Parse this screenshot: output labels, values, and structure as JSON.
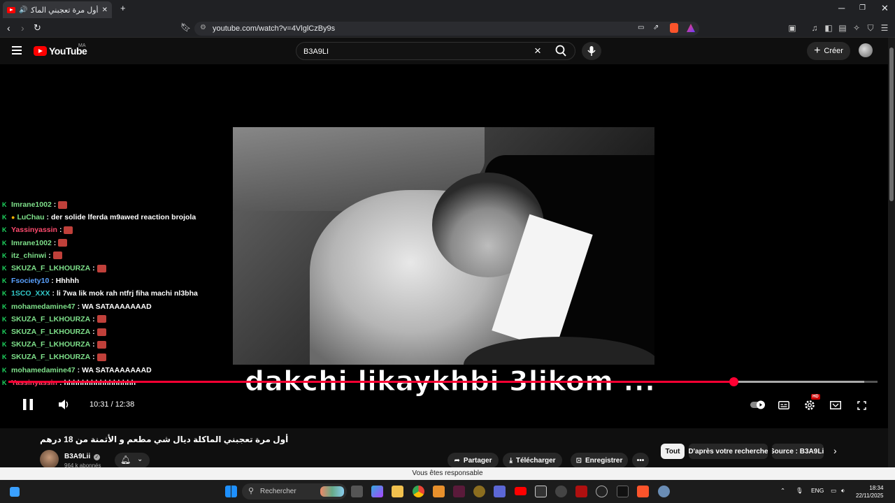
{
  "browser": {
    "tab_title": "أول مرة تعجبني الماكلة ديال شـ",
    "url": "youtube.com/watch?v=4VlglCzBy9s",
    "new_tab": "+",
    "close": "✕"
  },
  "youtube": {
    "logo_text": "YouTube",
    "country_code": "MA",
    "search_value": "B3A9LI",
    "create_label": "Créer"
  },
  "chat": [
    {
      "user": "Imrane1002",
      "user_color": "#7ee08a",
      "message": "",
      "emoji": true,
      "badge": false
    },
    {
      "user": "LuChau",
      "user_color": "#7ee08a",
      "message": "der solide lferda m9awed reaction brojola",
      "emoji": false,
      "badge": true
    },
    {
      "user": "Yassinyassin",
      "user_color": "#ff4b6e",
      "message": "",
      "emoji": true,
      "badge": false
    },
    {
      "user": "Imrane1002",
      "user_color": "#7ee08a",
      "message": "",
      "emoji": true,
      "badge": false
    },
    {
      "user": "itz_chinwi",
      "user_color": "#7ee08a",
      "message": "",
      "emoji": true,
      "badge": false
    },
    {
      "user": "SKUZA_F_LKHOURZA",
      "user_color": "#7ee08a",
      "message": "",
      "emoji": true,
      "badge": false
    },
    {
      "user": "Fsociety10",
      "user_color": "#5aa2ff",
      "message": "Hhhhh",
      "emoji": false,
      "badge": false
    },
    {
      "user": "1SCO_XXX",
      "user_color": "#32c8c8",
      "message": "li 7wa lik mok rah ntfrj fiha machi nl3bha",
      "emoji": false,
      "badge": false
    },
    {
      "user": "mohamedamine47",
      "user_color": "#7ee08a",
      "message": "WA SATAAAAAAAD",
      "emoji": false,
      "badge": false
    },
    {
      "user": "SKUZA_F_LKHOURZA",
      "user_color": "#7ee08a",
      "message": "",
      "emoji": true,
      "badge": false
    },
    {
      "user": "SKUZA_F_LKHOURZA",
      "user_color": "#7ee08a",
      "message": "",
      "emoji": true,
      "badge": false
    },
    {
      "user": "SKUZA_F_LKHOURZA",
      "user_color": "#7ee08a",
      "message": "",
      "emoji": true,
      "badge": false
    },
    {
      "user": "SKUZA_F_LKHOURZA",
      "user_color": "#7ee08a",
      "message": "",
      "emoji": true,
      "badge": false
    },
    {
      "user": "mohamedamine47",
      "user_color": "#7ee08a",
      "message": "WA SATAAAAAAAD",
      "emoji": false,
      "badge": false
    },
    {
      "user": "Yassinyassin",
      "user_color": "#ff4b6e",
      "message": "hhhhhhhhhhhhhhhh",
      "emoji": false,
      "badge": false
    }
  ],
  "player": {
    "subtitle": "dakchi likaykhbi 3likom  ...",
    "time": "10:31 / 12:38",
    "progress_fraction": 0.834,
    "buffered_fraction": 0.985,
    "accent": "#ff0033",
    "hd_badge": "HD"
  },
  "video": {
    "title": "أول مرة تعجبني الماكلة ديال شي مطعم و الأثمنة من 18 درهم",
    "channel": "B3A9Lii",
    "subscribers": "964 k abonnés",
    "actions": {
      "share": "Partager",
      "download": "Télécharger",
      "save": "Enregistrer"
    },
    "chips": [
      "Tout",
      "D'après votre recherche",
      "Source : B3A9Lii"
    ]
  },
  "notice": "Vous êtes responsable",
  "taskbar": {
    "search_placeholder": "Rechercher",
    "lang": "ENG",
    "time": "18:34",
    "date": "22/11/2025"
  }
}
